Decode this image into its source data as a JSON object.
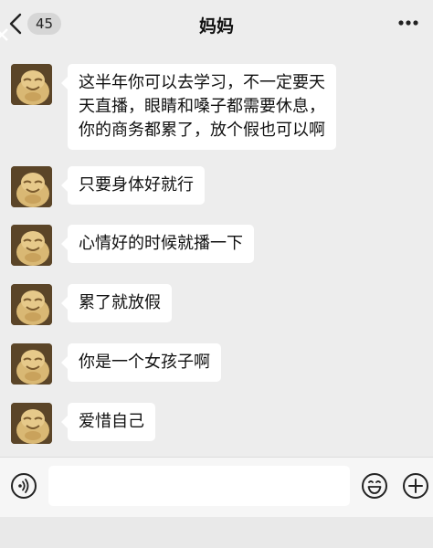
{
  "header": {
    "back_badge": "45",
    "title": "妈妈",
    "back_icon": "chevron-left-icon",
    "more_icon": "more-dots-icon"
  },
  "messages": [
    {
      "lines": [
        "这半年你可以去学习，不一定要天",
        "天直播，眼睛和嗓子都需要休息，",
        "你的商务都累了，放个假也可以啊"
      ]
    },
    {
      "lines": [
        "只要身体好就行"
      ]
    },
    {
      "lines": [
        "心情好的时候就播一下"
      ]
    },
    {
      "lines": [
        "累了就放假"
      ]
    },
    {
      "lines": [
        "你是一个女孩子啊"
      ]
    },
    {
      "lines": [
        "爱惜自己"
      ]
    }
  ],
  "input_bar": {
    "voice_icon": "voice-icon",
    "emoji_icon": "emoji-icon",
    "plus_icon": "plus-icon",
    "placeholder": ""
  },
  "colors": {
    "background": "#ededed",
    "bubble": "#ffffff",
    "input_bar": "#f6f6f6"
  }
}
